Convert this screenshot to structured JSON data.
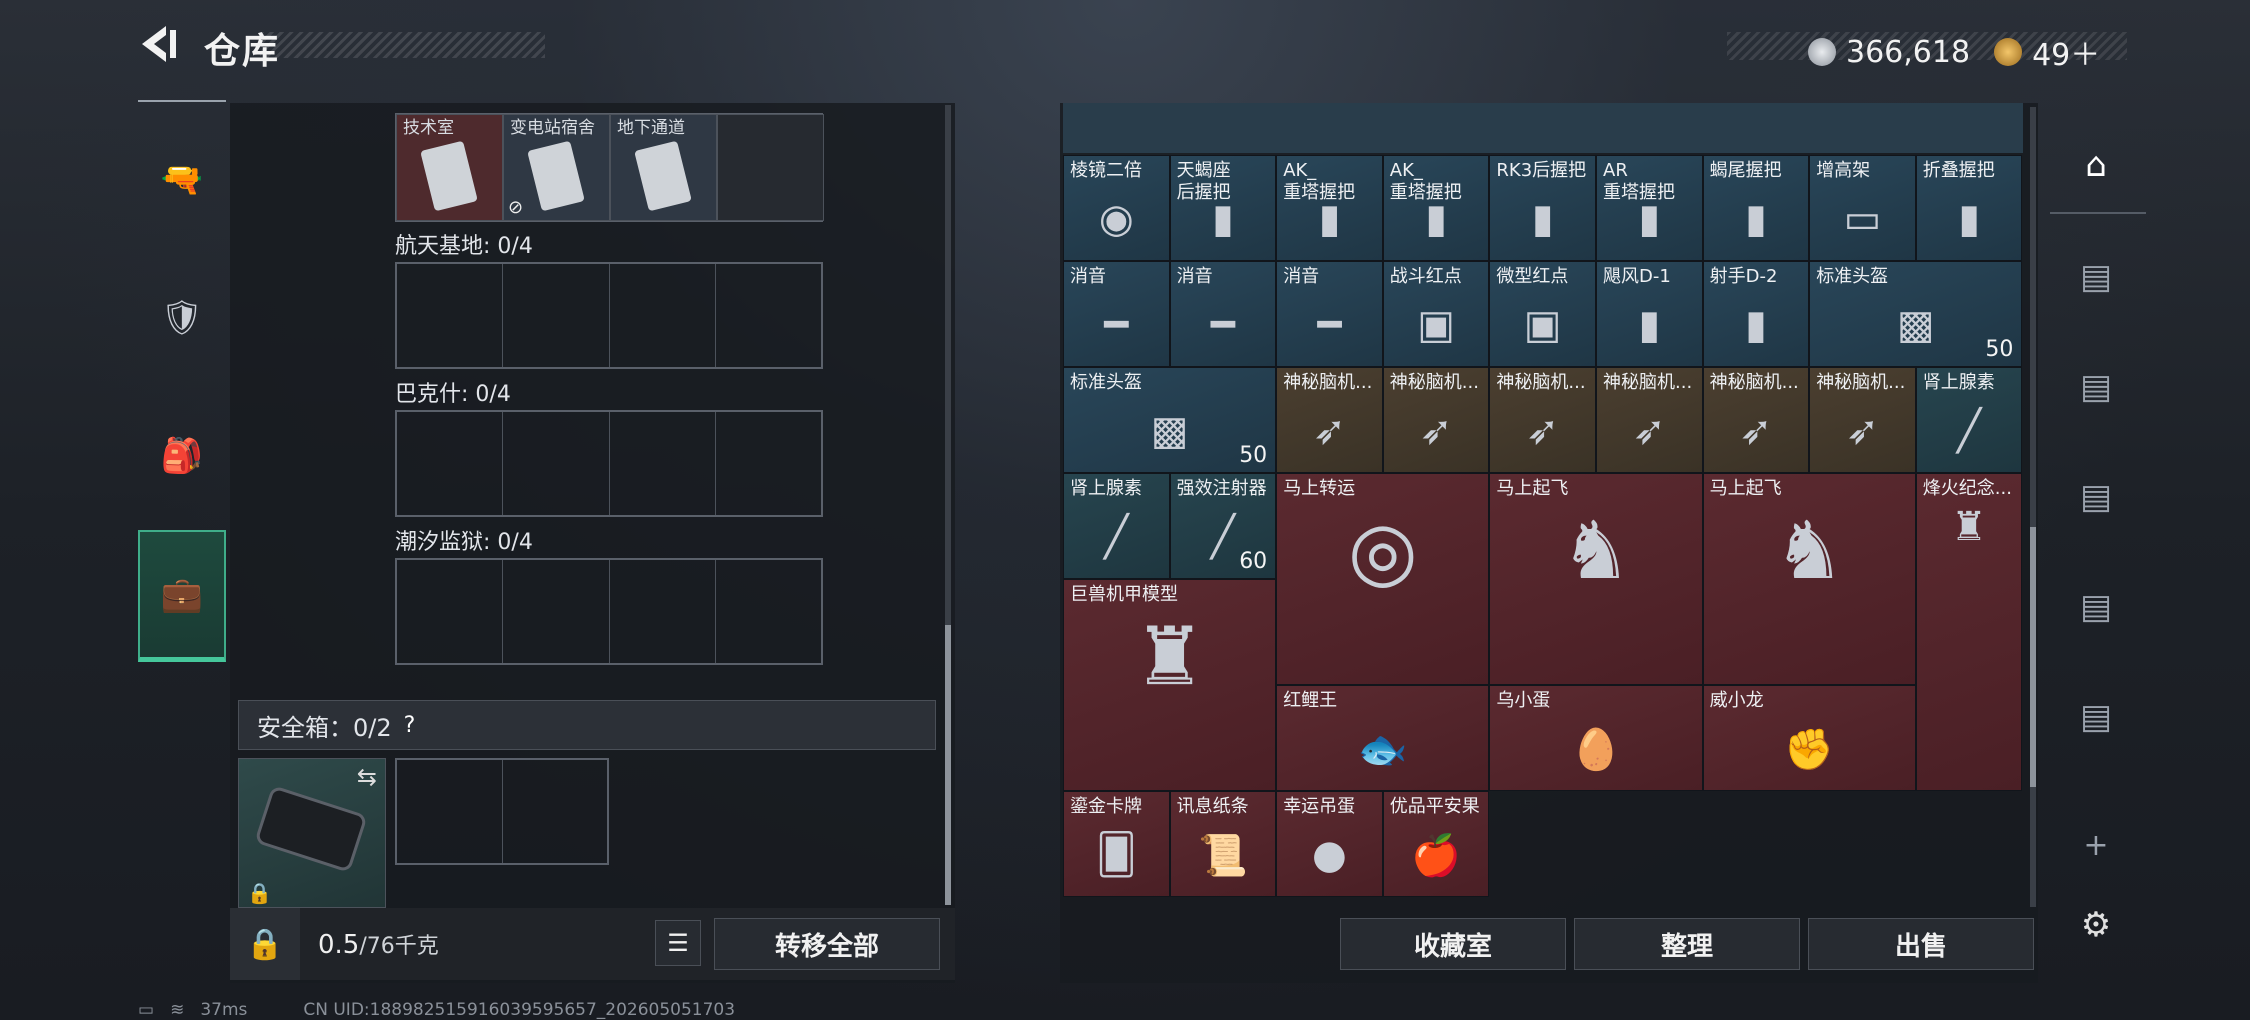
{
  "header": {
    "title": "仓库",
    "currency1": "366,618",
    "currency2": "49＋"
  },
  "left_tabs": [
    {
      "name": "weapon"
    },
    {
      "name": "armor"
    },
    {
      "name": "backpack"
    },
    {
      "name": "briefcase"
    }
  ],
  "key_slots": [
    {
      "label": "技术室"
    },
    {
      "label": "变电站宿舍"
    },
    {
      "label": "地下通道"
    }
  ],
  "sections": [
    {
      "label": "航天基地: 0/4"
    },
    {
      "label": "巴克什: 0/4"
    },
    {
      "label": "潮汐监狱: 0/4"
    }
  ],
  "safe_box": {
    "label": "安全箱：0/2",
    "help": "?"
  },
  "footer": {
    "weight": "0.5",
    "weight_unit": "/76千克",
    "transfer_all": "转移全部"
  },
  "items": [
    {
      "name": "棱镜二倍"
    },
    {
      "name": "天蝎座\n后握把"
    },
    {
      "name": "AK_\n重塔握把"
    },
    {
      "name": "AK_\n重塔握把"
    },
    {
      "name": "RK3后握把"
    },
    {
      "name": "AR\n重塔握把"
    },
    {
      "name": "蝎尾握把"
    },
    {
      "name": "增高架"
    },
    {
      "name": "折叠握把"
    },
    {
      "name": "消音"
    },
    {
      "name": "消音"
    },
    {
      "name": "消音"
    },
    {
      "name": "战斗红点"
    },
    {
      "name": "微型红点"
    },
    {
      "name": "飓风D-1"
    },
    {
      "name": "射手D-2"
    },
    {
      "name": "标准头盔",
      "count": "50"
    },
    {
      "name": "标准头盔",
      "count": "50"
    },
    {
      "name": "神秘脑机..."
    },
    {
      "name": "神秘脑机..."
    },
    {
      "name": "神秘脑机..."
    },
    {
      "name": "神秘脑机..."
    },
    {
      "name": "神秘脑机..."
    },
    {
      "name": "神秘脑机..."
    },
    {
      "name": "肾上腺素"
    },
    {
      "name": "肾上腺素"
    },
    {
      "name": "强效注射器",
      "count": "60"
    },
    {
      "name": "马上转运"
    },
    {
      "name": "马上起飞"
    },
    {
      "name": "马上起飞"
    },
    {
      "name": "烽火纪念..."
    },
    {
      "name": "巨兽机甲模型"
    },
    {
      "name": "红鲤王"
    },
    {
      "name": "乌小蛋"
    },
    {
      "name": "威小龙"
    },
    {
      "name": "鎏金卡牌"
    },
    {
      "name": "讯息纸条"
    },
    {
      "name": "幸运吊蛋"
    },
    {
      "name": "优品平安果"
    }
  ],
  "bottom_buttons": {
    "collection": "收藏室",
    "organize": "整理",
    "sell": "出售"
  },
  "status": {
    "ping": "37ms",
    "uid": "CN UID:1889825159160395956​57_202605051703"
  },
  "colors": {
    "accent": "#45c79b",
    "red_item": "#5b2a30",
    "blue_item": "#294659"
  }
}
